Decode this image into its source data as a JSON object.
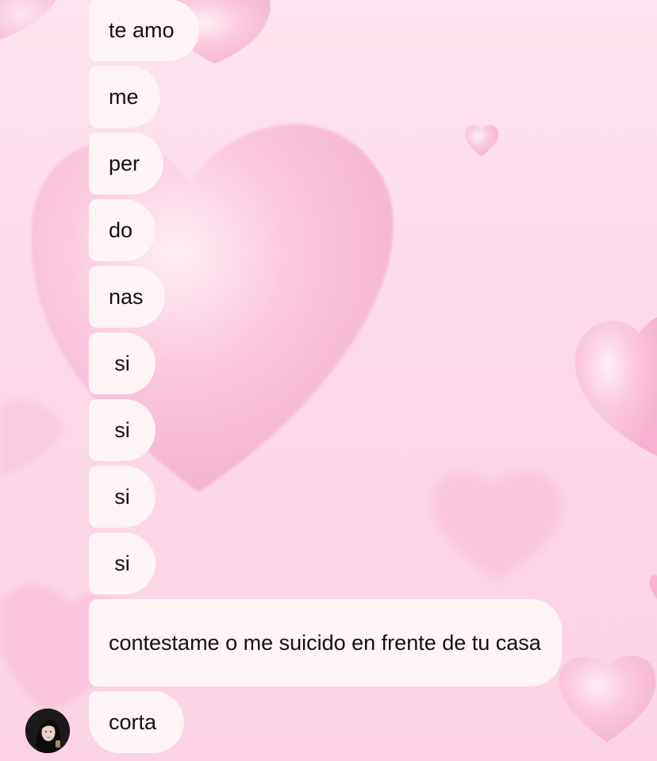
{
  "chat": {
    "messages": [
      {
        "text": "te amo"
      },
      {
        "text": "me"
      },
      {
        "text": "per"
      },
      {
        "text": "do"
      },
      {
        "text": "nas"
      },
      {
        "text": "si"
      },
      {
        "text": "si"
      },
      {
        "text": "si"
      },
      {
        "text": "si"
      },
      {
        "text": "contestame o me suicido en frente de tu casa"
      },
      {
        "text": "corta"
      }
    ]
  },
  "colors": {
    "background": "#fcd9e9",
    "hearts": "#f8b7d3",
    "bubble": "#fff4f6",
    "text": "#121212"
  },
  "icons": {
    "wallpaper": "pink-hearts-wallpaper",
    "avatar": "contact-avatar"
  }
}
